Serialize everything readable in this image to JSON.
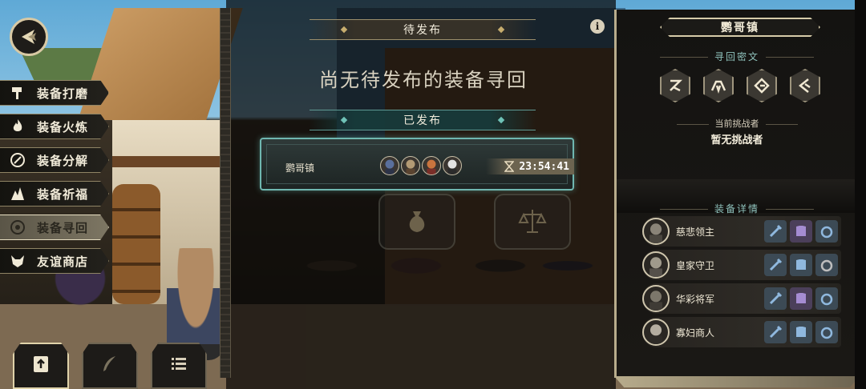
{
  "menu": {
    "items": [
      {
        "label": "装备打磨",
        "icon": "hammer-icon"
      },
      {
        "label": "装备火炼",
        "icon": "flame-icon"
      },
      {
        "label": "装备分解",
        "icon": "disassemble-icon"
      },
      {
        "label": "装备祈福",
        "icon": "pray-icon"
      },
      {
        "label": "装备寻回",
        "icon": "retrieve-icon",
        "active": true
      },
      {
        "label": "友谊商店",
        "icon": "fox-shop-icon"
      }
    ]
  },
  "center": {
    "pending_title": "待发布",
    "empty_message": "尚无待发布的装备寻回",
    "published_title": "已发布",
    "task": {
      "name": "鹦哥镇",
      "timer": "23:54:41"
    }
  },
  "right": {
    "town": "鹦哥镇",
    "cipher_title": "寻回密文",
    "challenger_label": "当前挑战者",
    "challenger_value": "暂无挑战者",
    "equip_title": "装备详情",
    "equips": [
      {
        "name": "慈悲领主",
        "slots": [
          "sword",
          "armor-purple",
          "ring-blue"
        ]
      },
      {
        "name": "皇家守卫",
        "slots": [
          "sword",
          "armor-blue",
          "ring-gray"
        ]
      },
      {
        "name": "华彩将军",
        "slots": [
          "sword",
          "armor-purple",
          "ring-blue"
        ]
      },
      {
        "name": "寡妇商人",
        "slots": [
          "sword",
          "armor-blue",
          "ring-blue"
        ]
      }
    ]
  },
  "colors": {
    "accent_teal": "#6fb7b0",
    "frame_gold": "#d6cba9",
    "panel_dark": "#141311"
  }
}
